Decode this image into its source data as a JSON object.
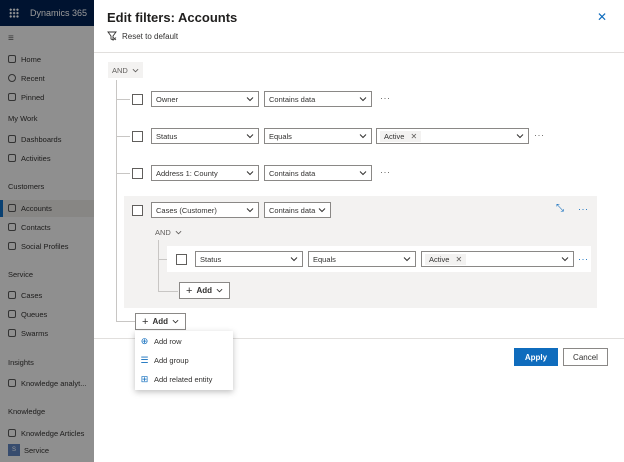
{
  "app": {
    "brand": "Dynamics 365",
    "area_badge": "S",
    "sidebar": {
      "items": [
        {
          "label": "Home",
          "icon": "home-icon"
        },
        {
          "label": "Recent",
          "icon": "clock-icon"
        },
        {
          "label": "Pinned",
          "icon": "pin-icon"
        }
      ],
      "sections": [
        {
          "heading": "My Work",
          "items": [
            "Dashboards",
            "Activities"
          ]
        },
        {
          "heading": "Customers",
          "items": [
            "Accounts",
            "Contacts",
            "Social Profiles"
          ]
        },
        {
          "heading": "Service",
          "items": [
            "Cases",
            "Queues",
            "Swarms"
          ]
        },
        {
          "heading": "Insights",
          "items": [
            "Knowledge analyt..."
          ]
        },
        {
          "heading": "Knowledge",
          "items": [
            "Knowledge Articles"
          ]
        }
      ],
      "area": "Service",
      "selected": "Accounts"
    }
  },
  "panel": {
    "title": "Edit filters: Accounts",
    "reset_label": "Reset to default",
    "root_operator": "AND",
    "rows": [
      {
        "field": "Owner",
        "operator": "Contains data"
      },
      {
        "field": "Status",
        "operator": "Equals",
        "value_tag": "Active"
      },
      {
        "field": "Address 1: County",
        "operator": "Contains data"
      }
    ],
    "group": {
      "field": "Cases (Customer)",
      "operator": "Contains data",
      "inner_operator": "AND",
      "inner_row": {
        "field": "Status",
        "operator": "Equals",
        "value_tag": "Active"
      },
      "add_label": "Add"
    },
    "add_label": "Add",
    "add_menu": [
      "Add row",
      "Add group",
      "Add related entity"
    ],
    "more_glyph": "···",
    "apply_label": "Apply",
    "cancel_label": "Cancel"
  },
  "colors": {
    "accent": "#0f6cbd",
    "topbar": "#002050"
  }
}
